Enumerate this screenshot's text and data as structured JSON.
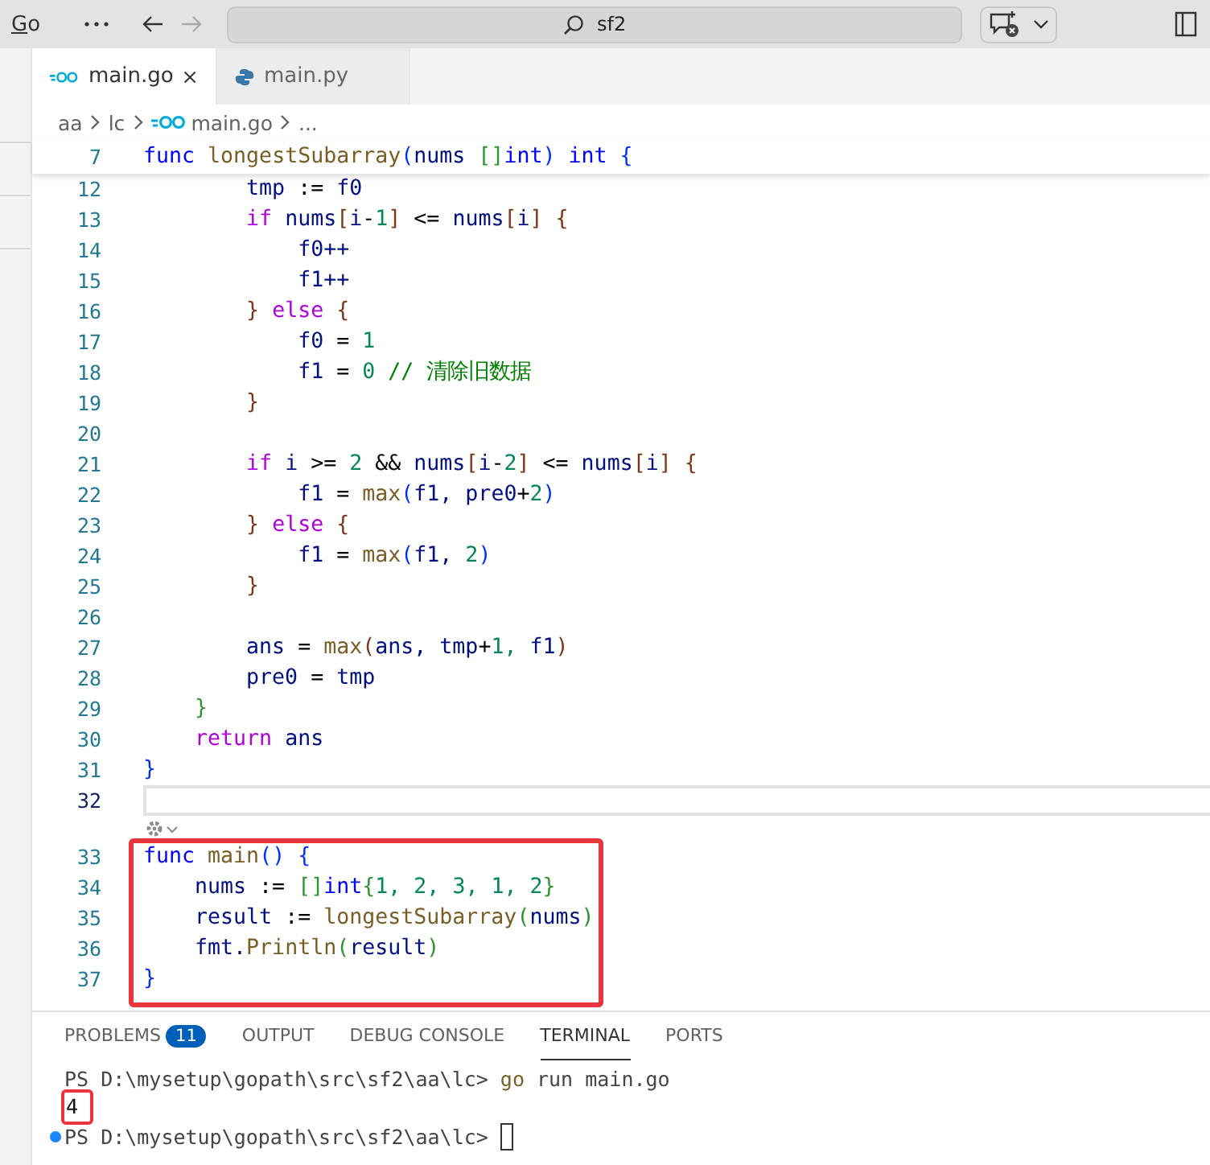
{
  "title_bar": {
    "menu": "Go",
    "back": {
      "disabled": false
    },
    "forward": {
      "disabled": true
    },
    "search": {
      "value": "sf2"
    }
  },
  "tabs": [
    {
      "label": "main.go",
      "kind": "go",
      "selected": true,
      "closable": true
    },
    {
      "label": "main.py",
      "kind": "python",
      "selected": false,
      "closable": false
    }
  ],
  "breadcrumb": [
    {
      "text": "aa",
      "kind": "folder"
    },
    {
      "text": "lc",
      "kind": "folder"
    },
    {
      "text": "main.go",
      "kind": "go"
    },
    {
      "text": "...",
      "kind": "more"
    }
  ],
  "sticky_line": {
    "number": "7",
    "tokens": [
      {
        "kind": "kw",
        "text": "func"
      },
      {
        "kind": "fn",
        "text": " longestSubarray"
      },
      {
        "kind": "b1",
        "text": "("
      },
      {
        "kind": "var",
        "text": "nums"
      },
      {
        "kind": "b2",
        "text": " []"
      },
      {
        "kind": "kw",
        "text": "int"
      },
      {
        "kind": "b1",
        "text": ")"
      },
      {
        "kind": "kw",
        "text": " int"
      },
      {
        "kind": "b1",
        "text": " {"
      }
    ]
  },
  "code_sections": [
    {
      "boxed": false,
      "lines": [
        {
          "kind": "code",
          "number": "12",
          "current": false,
          "tokens": [
            {
              "kind": "var",
              "text": "        tmp"
            },
            {
              "kind": "plain",
              "text": " :="
            },
            {
              "kind": "var",
              "text": " f0"
            }
          ]
        },
        {
          "kind": "code",
          "number": "13",
          "current": false,
          "tokens": [
            {
              "kind": "ctl",
              "text": "        if"
            },
            {
              "kind": "var",
              "text": " nums"
            },
            {
              "kind": "b3",
              "text": "["
            },
            {
              "kind": "var",
              "text": "i"
            },
            {
              "kind": "plain",
              "text": "-"
            },
            {
              "kind": "num",
              "text": "1"
            },
            {
              "kind": "b3",
              "text": "]"
            },
            {
              "kind": "plain",
              "text": " <="
            },
            {
              "kind": "var",
              "text": " nums"
            },
            {
              "kind": "b3",
              "text": "["
            },
            {
              "kind": "var",
              "text": "i"
            },
            {
              "kind": "b3",
              "text": "]"
            },
            {
              "kind": "b3",
              "text": " {"
            }
          ]
        },
        {
          "kind": "code",
          "number": "14",
          "current": false,
          "tokens": [
            {
              "kind": "var",
              "text": "            f0++"
            }
          ]
        },
        {
          "kind": "code",
          "number": "15",
          "current": false,
          "tokens": [
            {
              "kind": "var",
              "text": "            f1++"
            }
          ]
        },
        {
          "kind": "code",
          "number": "16",
          "current": false,
          "tokens": [
            {
              "kind": "b3",
              "text": "        }"
            },
            {
              "kind": "ctl",
              "text": " else"
            },
            {
              "kind": "b3",
              "text": " {"
            }
          ]
        },
        {
          "kind": "code",
          "number": "17",
          "current": false,
          "tokens": [
            {
              "kind": "var",
              "text": "            f0"
            },
            {
              "kind": "plain",
              "text": " ="
            },
            {
              "kind": "num",
              "text": " 1"
            }
          ]
        },
        {
          "kind": "code",
          "number": "18",
          "current": false,
          "tokens": [
            {
              "kind": "var",
              "text": "            f1"
            },
            {
              "kind": "plain",
              "text": " ="
            },
            {
              "kind": "num",
              "text": " 0"
            },
            {
              "kind": "cmt",
              "text": " // 清除旧数据"
            }
          ]
        },
        {
          "kind": "code",
          "number": "19",
          "current": false,
          "tokens": [
            {
              "kind": "b3",
              "text": "        }"
            }
          ]
        },
        {
          "kind": "code",
          "number": "20",
          "current": false
        },
        {
          "kind": "code",
          "number": "21",
          "current": false,
          "tokens": [
            {
              "kind": "ctl",
              "text": "        if"
            },
            {
              "kind": "var",
              "text": " i"
            },
            {
              "kind": "plain",
              "text": " >="
            },
            {
              "kind": "num",
              "text": " 2"
            },
            {
              "kind": "plain",
              "text": " &&"
            },
            {
              "kind": "var",
              "text": " nums"
            },
            {
              "kind": "b3",
              "text": "["
            },
            {
              "kind": "var",
              "text": "i"
            },
            {
              "kind": "plain",
              "text": "-"
            },
            {
              "kind": "num",
              "text": "2"
            },
            {
              "kind": "b3",
              "text": "]"
            },
            {
              "kind": "plain",
              "text": " <="
            },
            {
              "kind": "var",
              "text": " nums"
            },
            {
              "kind": "b3",
              "text": "["
            },
            {
              "kind": "var",
              "text": "i"
            },
            {
              "kind": "b3",
              "text": "]"
            },
            {
              "kind": "b3",
              "text": " {"
            }
          ]
        },
        {
          "kind": "code",
          "number": "22",
          "current": false,
          "tokens": [
            {
              "kind": "var",
              "text": "            f1"
            },
            {
              "kind": "plain",
              "text": " ="
            },
            {
              "kind": "fn",
              "text": " max"
            },
            {
              "kind": "b1",
              "text": "("
            },
            {
              "kind": "var",
              "text": "f1,"
            },
            {
              "kind": "var",
              "text": " pre0"
            },
            {
              "kind": "plain",
              "text": "+"
            },
            {
              "kind": "num",
              "text": "2"
            },
            {
              "kind": "b1",
              "text": ")"
            }
          ]
        },
        {
          "kind": "code",
          "number": "23",
          "current": false,
          "tokens": [
            {
              "kind": "b3",
              "text": "        }"
            },
            {
              "kind": "ctl",
              "text": " else"
            },
            {
              "kind": "b3",
              "text": " {"
            }
          ]
        },
        {
          "kind": "code",
          "number": "24",
          "current": false,
          "tokens": [
            {
              "kind": "var",
              "text": "            f1"
            },
            {
              "kind": "plain",
              "text": " ="
            },
            {
              "kind": "fn",
              "text": " max"
            },
            {
              "kind": "b1",
              "text": "("
            },
            {
              "kind": "var",
              "text": "f1,"
            },
            {
              "kind": "num",
              "text": " 2"
            },
            {
              "kind": "b1",
              "text": ")"
            }
          ]
        },
        {
          "kind": "code",
          "number": "25",
          "current": false,
          "tokens": [
            {
              "kind": "b3",
              "text": "        }"
            }
          ]
        },
        {
          "kind": "code",
          "number": "26",
          "current": false
        },
        {
          "kind": "code",
          "number": "27",
          "current": false,
          "tokens": [
            {
              "kind": "var",
              "text": "        ans"
            },
            {
              "kind": "plain",
              "text": " ="
            },
            {
              "kind": "fn",
              "text": " max"
            },
            {
              "kind": "b3",
              "text": "("
            },
            {
              "kind": "var",
              "text": "ans,"
            },
            {
              "kind": "var",
              "text": " tmp"
            },
            {
              "kind": "plain",
              "text": "+"
            },
            {
              "kind": "num",
              "text": "1,"
            },
            {
              "kind": "var",
              "text": " f1"
            },
            {
              "kind": "b3",
              "text": ")"
            }
          ]
        },
        {
          "kind": "code",
          "number": "28",
          "current": false,
          "tokens": [
            {
              "kind": "var",
              "text": "        pre0"
            },
            {
              "kind": "plain",
              "text": " ="
            },
            {
              "kind": "var",
              "text": " tmp"
            }
          ]
        },
        {
          "kind": "code",
          "number": "29",
          "current": false,
          "tokens": [
            {
              "kind": "b2",
              "text": "    }"
            }
          ]
        },
        {
          "kind": "code",
          "number": "30",
          "current": false,
          "tokens": [
            {
              "kind": "ctl",
              "text": "    return"
            },
            {
              "kind": "var",
              "text": " ans"
            }
          ]
        },
        {
          "kind": "code",
          "number": "31",
          "current": false,
          "tokens": [
            {
              "kind": "b1",
              "text": "}"
            }
          ]
        },
        {
          "kind": "code",
          "number": "32",
          "current": true
        },
        {
          "kind": "codelens"
        }
      ]
    },
    {
      "boxed": true,
      "lines": [
        {
          "kind": "code",
          "number": "33",
          "current": false,
          "tokens": [
            {
              "kind": "kw",
              "text": "func"
            },
            {
              "kind": "fn",
              "text": " main"
            },
            {
              "kind": "b1",
              "text": "()"
            },
            {
              "kind": "b1",
              "text": " {"
            }
          ]
        },
        {
          "kind": "code",
          "number": "34",
          "current": false,
          "tokens": [
            {
              "kind": "var",
              "text": "    nums"
            },
            {
              "kind": "plain",
              "text": " :="
            },
            {
              "kind": "b2",
              "text": " []"
            },
            {
              "kind": "kw",
              "text": "int"
            },
            {
              "kind": "b2",
              "text": "{"
            },
            {
              "kind": "num",
              "text": "1,"
            },
            {
              "kind": "num",
              "text": " 2,"
            },
            {
              "kind": "num",
              "text": " 3,"
            },
            {
              "kind": "num",
              "text": " 1,"
            },
            {
              "kind": "num",
              "text": " 2"
            },
            {
              "kind": "b2",
              "text": "}"
            }
          ]
        },
        {
          "kind": "code",
          "number": "35",
          "current": false,
          "tokens": [
            {
              "kind": "var",
              "text": "    result"
            },
            {
              "kind": "plain",
              "text": " :="
            },
            {
              "kind": "fn",
              "text": " longestSubarray"
            },
            {
              "kind": "b2",
              "text": "("
            },
            {
              "kind": "var",
              "text": "nums"
            },
            {
              "kind": "b2",
              "text": ")"
            }
          ]
        },
        {
          "kind": "code",
          "number": "36",
          "current": false,
          "tokens": [
            {
              "kind": "var",
              "text": "    fmt."
            },
            {
              "kind": "fn",
              "text": "Println"
            },
            {
              "kind": "b2",
              "text": "("
            },
            {
              "kind": "var",
              "text": "result"
            },
            {
              "kind": "b2",
              "text": ")"
            }
          ]
        },
        {
          "kind": "code",
          "number": "37",
          "current": false,
          "tokens": [
            {
              "kind": "b1",
              "text": "}"
            }
          ]
        }
      ]
    }
  ],
  "panel": {
    "tabs": [
      {
        "label": "PROBLEMS",
        "badge": "11",
        "selected": false
      },
      {
        "label": "OUTPUT",
        "selected": false
      },
      {
        "label": "DEBUG CONSOLE",
        "selected": false
      },
      {
        "label": "TERMINAL",
        "selected": true
      },
      {
        "label": "PORTS",
        "selected": false
      }
    ],
    "terminal_lines": [
      {
        "kind": "command",
        "dot": false,
        "boxed": false,
        "cursor": false,
        "tokens": [
          {
            "kind": "plain",
            "text": "PS D:\\mysetup\\gopath\\src\\sf2\\aa\\lc>"
          },
          {
            "kind": "cmd",
            "text": " go"
          },
          {
            "kind": "plain",
            "text": " run main.go"
          }
        ]
      },
      {
        "kind": "output",
        "dot": false,
        "boxed": true,
        "cursor": false,
        "tokens": [
          {
            "kind": "plain",
            "text": "4"
          }
        ]
      },
      {
        "kind": "command",
        "dot": true,
        "boxed": false,
        "cursor": true,
        "tokens": [
          {
            "kind": "plain",
            "text": "PS D:\\mysetup\\gopath\\src\\sf2\\aa\\lc>"
          }
        ]
      }
    ]
  }
}
